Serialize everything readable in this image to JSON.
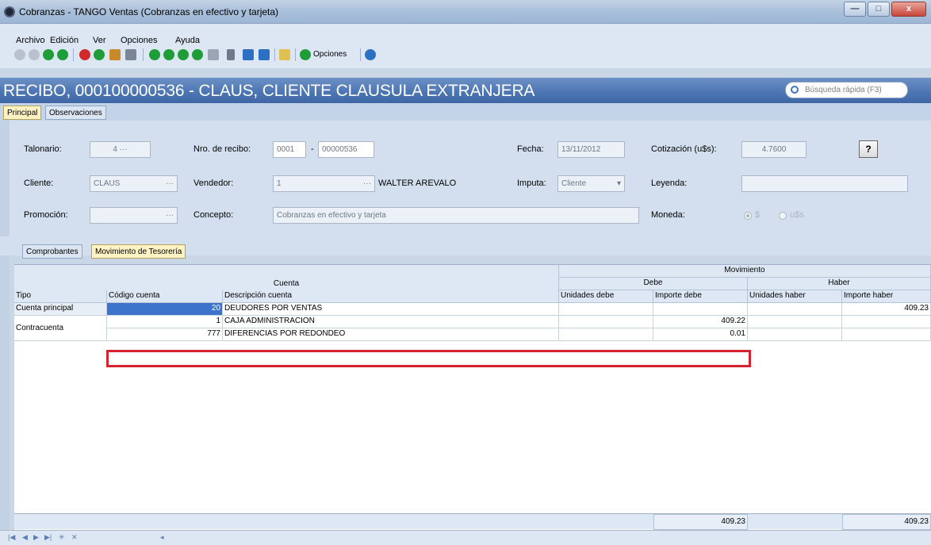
{
  "window": {
    "title": "Cobranzas - TANGO Ventas (Cobranzas en efectivo y tarjeta)",
    "buttons": {
      "minimize": "—",
      "maximize": "□",
      "close": "x"
    }
  },
  "menu": {
    "items": [
      "Archivo",
      "Edición",
      "Ver",
      "Opciones",
      "Ayuda"
    ]
  },
  "toolbar": {
    "options_label": "Opciones",
    "colors": {
      "green": "#1f9d39",
      "red": "#d12a2a",
      "blue": "#2d6fc2",
      "gray": "#9aa6b6"
    }
  },
  "header": {
    "title": "RECIBO, 000100000536 - CLAUS, CLIENTE CLAUSULA EXTRANJERA",
    "search_placeholder": "Búsqueda rápida (F3)"
  },
  "tabs_top": {
    "principal": "Principal",
    "observaciones": "Observaciones"
  },
  "form": {
    "talonario": {
      "label": "Talonario:",
      "value": "4"
    },
    "nro_recibo": {
      "label": "Nro. de recibo:",
      "part1": "0001",
      "part2": "00000536"
    },
    "fecha": {
      "label": "Fecha:",
      "value": "13/11/2012"
    },
    "cotizacion": {
      "label": "Cotización (u$s):",
      "value": "4.7600"
    },
    "help_button": "?",
    "cliente": {
      "label": "Cliente:",
      "value": "CLAUS"
    },
    "vendedor": {
      "label": "Vendedor:",
      "code": "1",
      "name": "WALTER AREVALO"
    },
    "imputa": {
      "label": "Imputa:",
      "value": "Cliente"
    },
    "leyenda": {
      "label": "Leyenda:",
      "value": ""
    },
    "promocion": {
      "label": "Promoción:",
      "value": ""
    },
    "concepto": {
      "label": "Concepto:",
      "value": "Cobranzas en efectivo y tarjeta"
    },
    "moneda": {
      "label": "Moneda:",
      "option_peso": "$",
      "option_usd": "u$s"
    }
  },
  "tabs_bottom": {
    "comprobantes": "Comprobantes",
    "movimiento": "Movimiento de Tesorería"
  },
  "grid": {
    "group_cuenta": "Cuenta",
    "group_movimiento": "Movimiento",
    "group_debe": "Debe",
    "group_haber": "Haber",
    "headers": [
      "Tipo",
      "Código cuenta",
      "Descripción cuenta",
      "Unidades debe",
      "Importe debe",
      "Unidades haber",
      "Importe haber"
    ],
    "rows": [
      {
        "tipo": "Cuenta principal",
        "codigo": "20",
        "descripcion": "DEUDORES POR VENTAS",
        "unidades_debe": "",
        "importe_debe": "",
        "unidades_haber": "",
        "importe_haber": "409.23"
      },
      {
        "tipo": "Contracuenta",
        "codigo": "1",
        "descripcion": "CAJA ADMINISTRACION",
        "unidades_debe": "",
        "importe_debe": "409.22",
        "unidades_haber": "",
        "importe_haber": ""
      },
      {
        "tipo": "",
        "codigo": "777",
        "descripcion": "DIFERENCIAS POR REDONDEO",
        "unidades_debe": "",
        "importe_debe": "0.01",
        "unidades_haber": "",
        "importe_haber": ""
      }
    ],
    "totals": {
      "importe_debe": "409.23",
      "importe_haber": "409.23"
    },
    "highlight_color": "#d62230"
  }
}
